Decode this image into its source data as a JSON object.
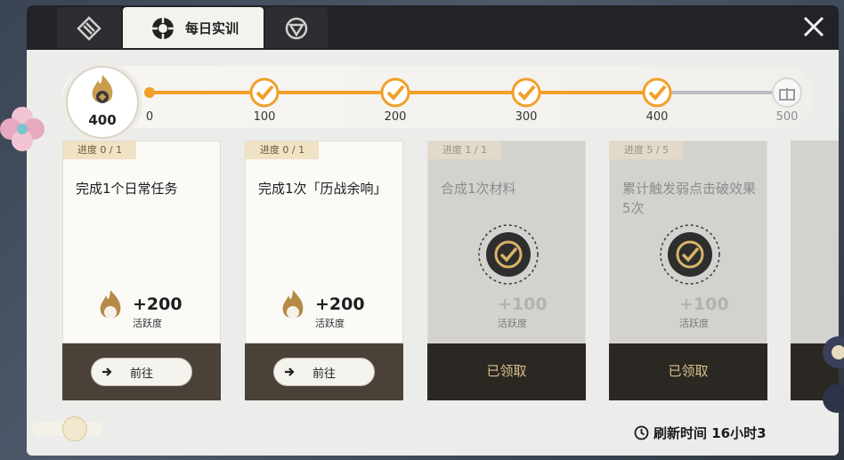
{
  "tabs": [
    {
      "label": "",
      "icon": "diamond-shield-icon"
    },
    {
      "label": "每日实训",
      "icon": "gear-emblem-icon"
    },
    {
      "label": "",
      "icon": "triangle-target-icon"
    }
  ],
  "activity": {
    "current": "400"
  },
  "milestones": [
    {
      "label": "0"
    },
    {
      "label": "100"
    },
    {
      "label": "200"
    },
    {
      "label": "300"
    },
    {
      "label": "400"
    },
    {
      "label": "500"
    }
  ],
  "tasks": [
    {
      "progress": "进度 0 / 1",
      "text": "完成1个日常任务",
      "reward": "+200",
      "reward_unit": "活跃度",
      "action": "前往",
      "claimed": false
    },
    {
      "progress": "进度 0 / 1",
      "text": "完成1次「历战余响」",
      "reward": "+200",
      "reward_unit": "活跃度",
      "action": "前往",
      "claimed": false
    },
    {
      "progress": "进度 1 / 1",
      "text": "合成1次材料",
      "reward": "+100",
      "reward_unit": "活跃度",
      "action": "已领取",
      "claimed": true
    },
    {
      "progress": "进度 5 / 5",
      "text": "累计触发弱点击破效果5次",
      "reward": "+100",
      "reward_unit": "活跃度",
      "action": "已领取",
      "claimed": true
    }
  ],
  "footer": {
    "refresh": "刷新时间 16小时3"
  },
  "colors": {
    "accent": "#f1a02a",
    "dark": "#222326",
    "card_bottom": "#4a4239",
    "claimed_text": "#d8c08a"
  }
}
